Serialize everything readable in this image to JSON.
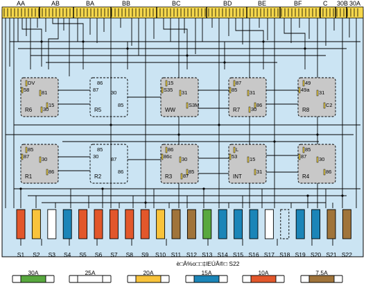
{
  "connectors": [
    "AA",
    "AB",
    "BA",
    "BB",
    "BC",
    "BD",
    "BE",
    "BF",
    "C",
    "30B",
    "30A"
  ],
  "relays": [
    {
      "name": "R6",
      "pins": [
        "DV",
        "58",
        "81",
        "15",
        "30"
      ]
    },
    {
      "name": "R5",
      "pins": [
        "86",
        "87",
        "30",
        "85"
      ]
    },
    {
      "name": "WW",
      "pins": [
        "15",
        "S35",
        "31",
        "S3M"
      ]
    },
    {
      "name": "R7",
      "pins": [
        "87",
        "85",
        "31",
        "86",
        "30"
      ]
    },
    {
      "name": "R8",
      "pins": [
        "49",
        "49a",
        "31",
        "C2"
      ]
    },
    {
      "name": "R1",
      "pins": [
        "85",
        "87",
        "30",
        "86"
      ]
    },
    {
      "name": "R2",
      "pins": [
        "85",
        "30",
        "87",
        "86"
      ]
    },
    {
      "name": "R3",
      "pins": [
        "86",
        "86c",
        "30",
        "85",
        "87"
      ]
    },
    {
      "name": "INT",
      "pins": [
        "L",
        "53",
        "15",
        "31"
      ]
    },
    {
      "name": "R4",
      "pins": [
        "85",
        "87",
        "30",
        "86"
      ]
    }
  ],
  "fuses": [
    {
      "label": "S1",
      "color": "#e2572b"
    },
    {
      "label": "S2",
      "color": "#f8c33b"
    },
    {
      "label": "S3",
      "color": "#ffffff"
    },
    {
      "label": "S4",
      "color": "#1b85b8"
    },
    {
      "label": "S5",
      "color": "#e2572b"
    },
    {
      "label": "S6",
      "color": "#e2572b"
    },
    {
      "label": "S7",
      "color": "#e2572b"
    },
    {
      "label": "S8",
      "color": "#e2572b"
    },
    {
      "label": "S9",
      "color": "#e2572b"
    },
    {
      "label": "S10",
      "color": "#f8c33b"
    },
    {
      "label": "S11",
      "color": "#a0743a"
    },
    {
      "label": "S12",
      "color": "#a0743a"
    },
    {
      "label": "S13",
      "color": "#58a83e"
    },
    {
      "label": "S14",
      "color": "#1b85b8"
    },
    {
      "label": "S15",
      "color": "#1b85b8"
    },
    {
      "label": "S16",
      "color": "#1b85b8"
    },
    {
      "label": "S17",
      "color": "#ffffff"
    },
    {
      "label": "S18",
      "color": "none"
    },
    {
      "label": "S19",
      "color": "#1b85b8"
    },
    {
      "label": "S20",
      "color": "#1b85b8"
    },
    {
      "label": "S21",
      "color": "#a0743a"
    },
    {
      "label": "S22",
      "color": "#a0743a"
    }
  ],
  "caption": "è□Â%o□□‡lEÚÂ®□ S22",
  "legend": [
    {
      "label": "30A",
      "color": "#58a83e"
    },
    {
      "label": "25A",
      "color": "#ffffff"
    },
    {
      "label": "20A",
      "color": "#f8c33b"
    },
    {
      "label": "15A",
      "color": "#1b85b8"
    },
    {
      "label": "10A",
      "color": "#e2572b"
    },
    {
      "label": "7.5A",
      "color": "#a0743a"
    }
  ]
}
